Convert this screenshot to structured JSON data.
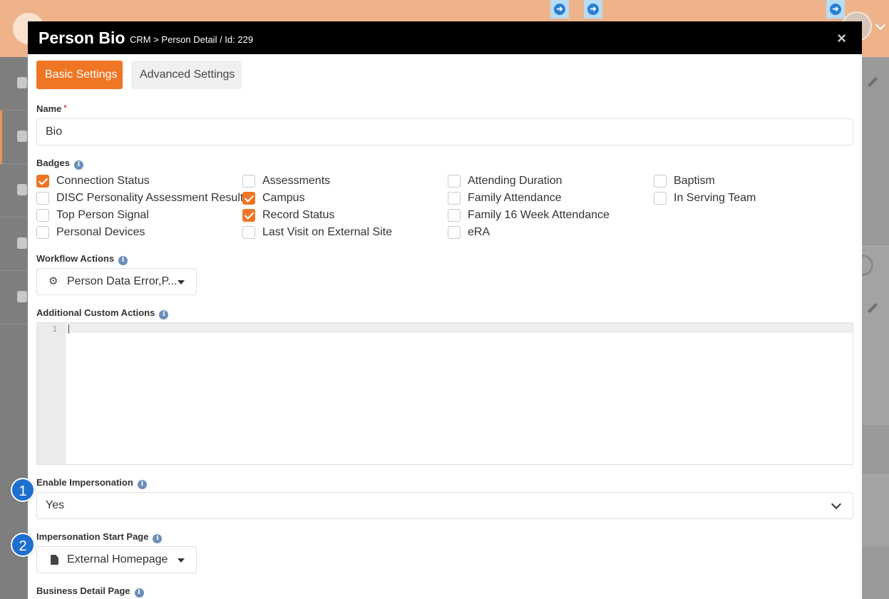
{
  "modal": {
    "title": "Person Bio",
    "breadcrumb": "CRM > Person Detail / Id: 229",
    "close": "×"
  },
  "tabs": {
    "basic": "Basic Settings",
    "advanced": "Advanced Settings"
  },
  "name_field": {
    "label": "Name",
    "required_marker": "•",
    "value": "Bio"
  },
  "badges": {
    "label": "Badges",
    "items": [
      {
        "label": "Connection Status",
        "checked": true
      },
      {
        "label": "DISC Personality Assessment Result",
        "checked": false
      },
      {
        "label": "Top Person Signal",
        "checked": false
      },
      {
        "label": "Personal Devices",
        "checked": false
      },
      {
        "label": "Assessments",
        "checked": false
      },
      {
        "label": "Campus",
        "checked": true
      },
      {
        "label": "Record Status",
        "checked": true
      },
      {
        "label": "Last Visit on External Site",
        "checked": false
      },
      {
        "label": "Attending Duration",
        "checked": false
      },
      {
        "label": "Family Attendance",
        "checked": false
      },
      {
        "label": "Family 16 Week Attendance",
        "checked": false
      },
      {
        "label": "eRA",
        "checked": false
      },
      {
        "label": "Baptism",
        "checked": false
      },
      {
        "label": "In Serving Team",
        "checked": false
      }
    ]
  },
  "workflow_actions": {
    "label": "Workflow Actions",
    "value": "Person Data Error,P...",
    "icon": "gears-icon"
  },
  "custom_actions": {
    "label": "Additional Custom Actions",
    "line_number": "1"
  },
  "impersonation": {
    "label": "Enable Impersonation",
    "value": "Yes"
  },
  "impersonation_start": {
    "label": "Impersonation Start Page",
    "value": "External Homepage",
    "icon": "file-icon"
  },
  "business_detail": {
    "label": "Business Detail Page"
  },
  "callouts": {
    "one": "1",
    "two": "2"
  },
  "info_glyph": "i",
  "colors": {
    "accent": "#ee7625",
    "header": "#000000",
    "callout": "#1f6fcf",
    "topbar": "#eeb38a"
  }
}
